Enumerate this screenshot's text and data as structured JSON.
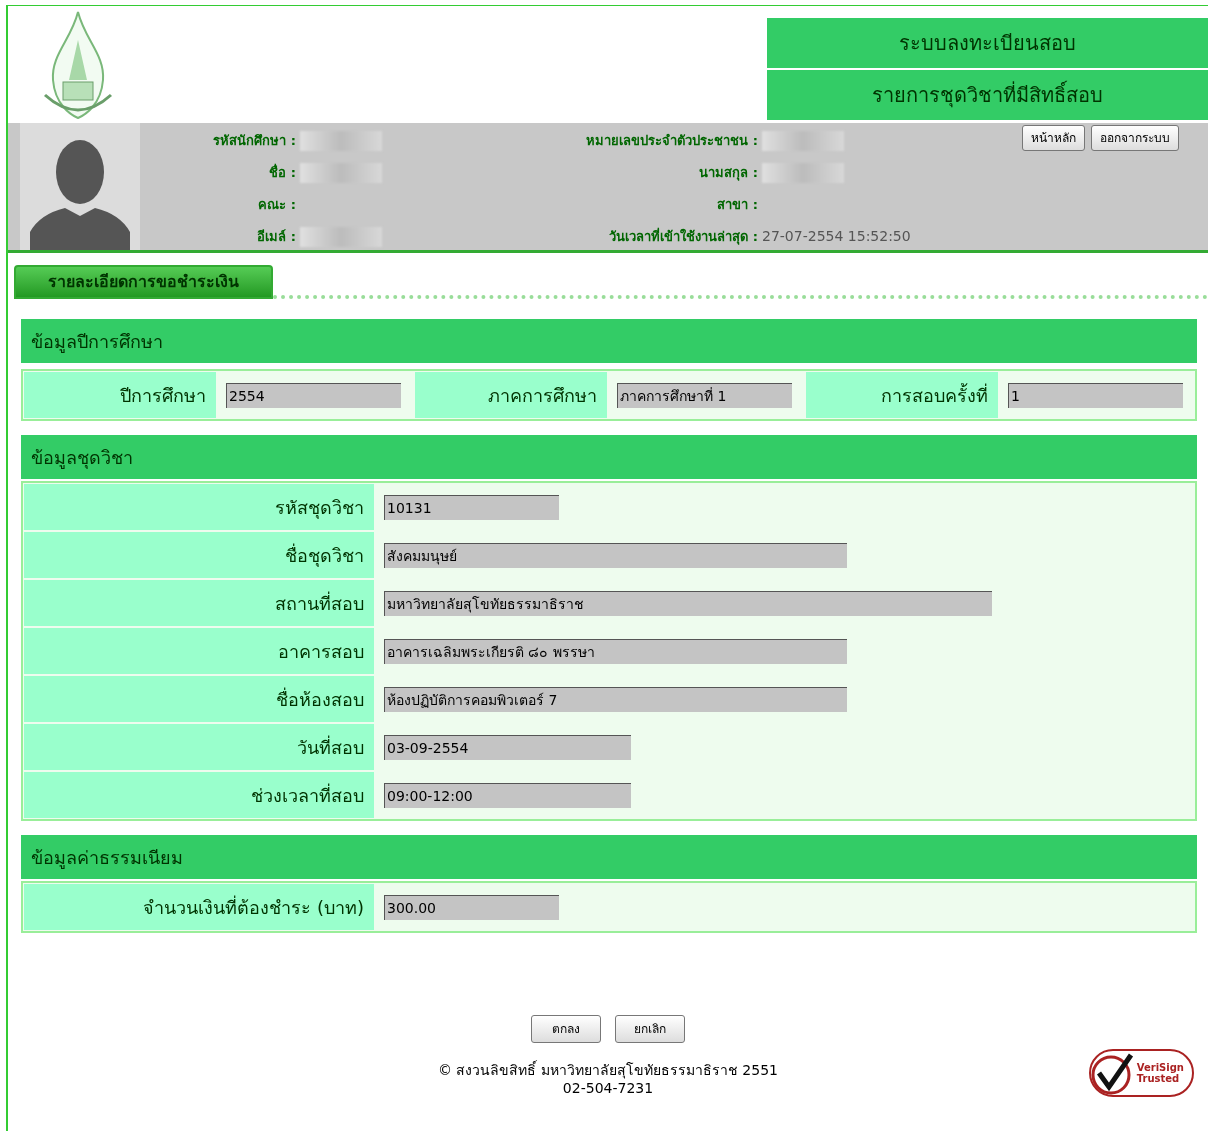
{
  "header": {
    "titles": [
      "ระบบลงทะเบียนสอบ",
      "รายการชุดวิชาที่มีสิทธิ์สอบ"
    ]
  },
  "profile": {
    "fields": [
      {
        "label": "รหัสนักศึกษา :",
        "redacted": true
      },
      {
        "label": "หมายเลขประจำตัวประชาชน :",
        "redacted": true
      },
      {
        "label": "ชื่อ :",
        "redacted": true
      },
      {
        "label": "นามสกุล :",
        "redacted": true
      },
      {
        "label": "คณะ :",
        "redacted": false
      },
      {
        "label": "สาขา :",
        "redacted": false
      },
      {
        "label": "อีเมล์ :",
        "redacted": true
      },
      {
        "label": "วันเวลาที่เข้าใช้งานล่าสุด :",
        "value": "27-07-2554 15:52:50",
        "redacted": false
      }
    ],
    "buttons": [
      "หน้าหลัก",
      "ออกจากระบบ"
    ]
  },
  "tab": {
    "label": "รายละเอียดการขอชำระเงิน"
  },
  "year_section": {
    "title": "ข้อมูลปีการศึกษา",
    "fields": [
      {
        "label": "ปีการศึกษา",
        "value": "2554"
      },
      {
        "label": "ภาคการศึกษา",
        "value": "ภาคการศึกษาที่ 1"
      },
      {
        "label": "การสอบครั้งที่",
        "value": "1"
      }
    ]
  },
  "course_section": {
    "title": "ข้อมูลชุดวิชา",
    "fields": [
      {
        "label": "รหัสชุดวิชา",
        "value": "10131"
      },
      {
        "label": "ชื่อชุดวิชา",
        "value": "สังคมมนุษย์"
      },
      {
        "label": "สถานที่สอบ",
        "value": "มหาวิทยาลัยสุโขทัยธรรมาธิราช"
      },
      {
        "label": "อาคารสอบ",
        "value": "อาคารเฉลิมพระเกียรติ ๘๐ พรรษา"
      },
      {
        "label": "ชื่อห้องสอบ",
        "value": "ห้องปฏิบัติการคอมพิวเตอร์ 7"
      },
      {
        "label": "วันที่สอบ",
        "value": "03-09-2554"
      },
      {
        "label": "ช่วงเวลาที่สอบ",
        "value": "09:00-12:00"
      }
    ]
  },
  "fee_section": {
    "title": "ข้อมูลค่าธรรมเนียม",
    "fields": [
      {
        "label": "จำนวนเงินที่ต้องชำระ (บาท)",
        "value": "300.00"
      }
    ]
  },
  "actions": [
    "ตกลง",
    "ยกเลิก"
  ],
  "footer": {
    "lines": [
      "© สงวนลิขสิทธิ์ มหาวิทยาลัยสุโขทัยธรรมาธิราช 2551",
      "02-504-7231"
    ],
    "badge": [
      "VeriSign",
      "Trusted"
    ]
  }
}
